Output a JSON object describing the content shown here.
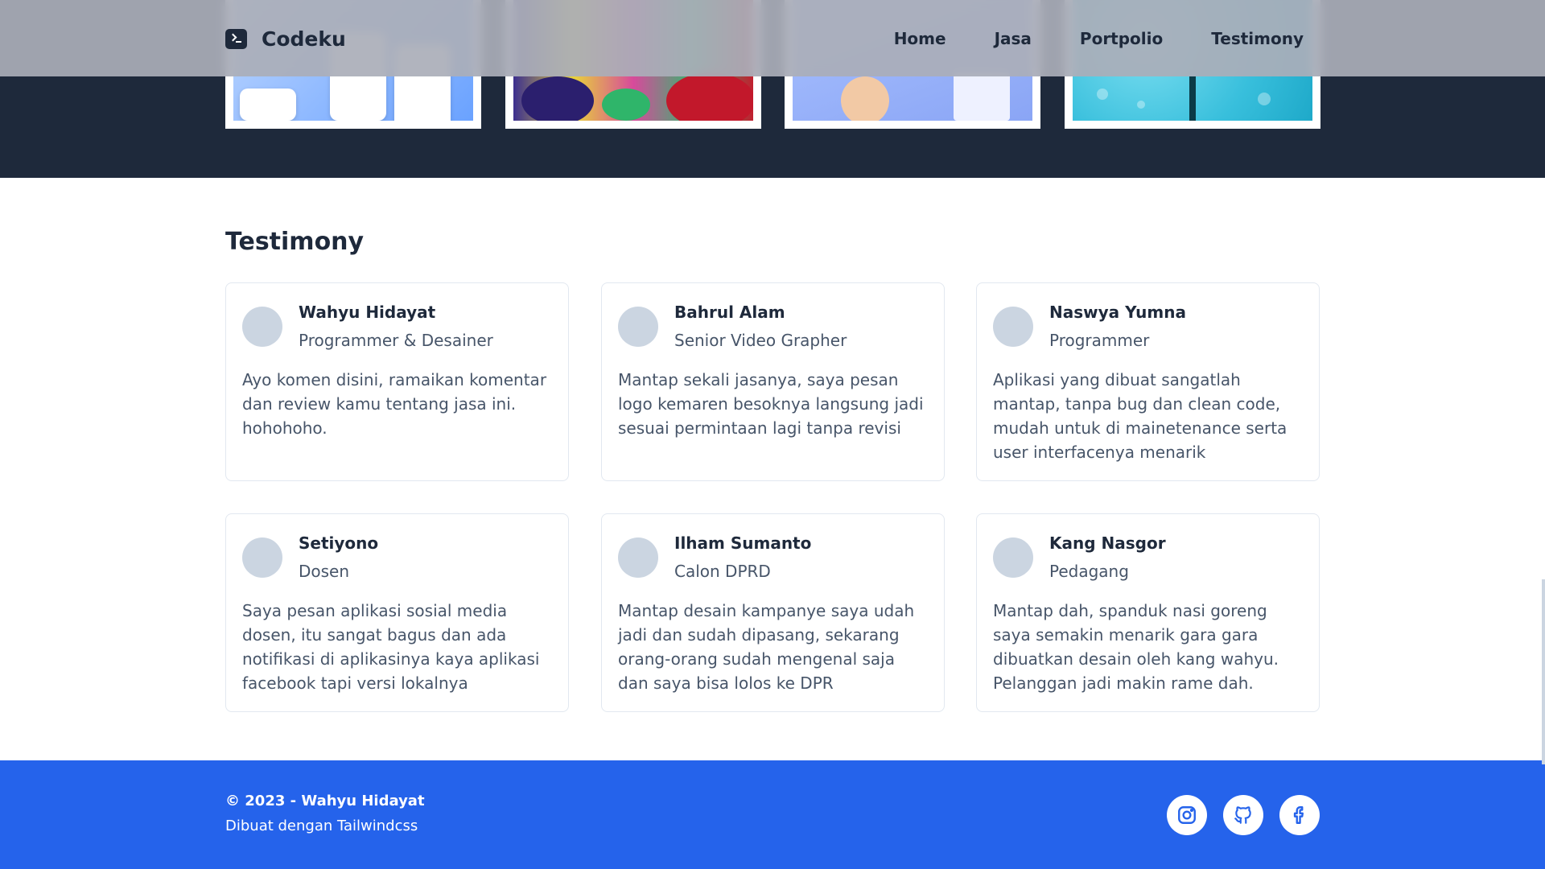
{
  "brand": {
    "name": "Codeku",
    "icon": "terminal-icon"
  },
  "nav": {
    "items": [
      "Home",
      "Jasa",
      "Portpolio",
      "Testimony"
    ]
  },
  "testimony": {
    "title": "Testimony",
    "items": [
      {
        "name": "Wahyu Hidayat",
        "role": "Programmer & Desainer",
        "text": "Ayo komen disini, ramaikan komentar dan review kamu tentang jasa ini. hohohoho."
      },
      {
        "name": "Bahrul Alam",
        "role": "Senior Video Grapher",
        "text": "Mantap sekali jasanya, saya pesan logo kemaren besoknya langsung jadi sesuai permintaan lagi tanpa revisi"
      },
      {
        "name": "Naswya Yumna",
        "role": "Programmer",
        "text": "Aplikasi yang dibuat sangatlah mantap, tanpa bug dan clean code, mudah untuk di mainetenance serta user interfacenya menarik"
      },
      {
        "name": "Setiyono",
        "role": "Dosen",
        "text": "Saya pesan aplikasi sosial media dosen, itu sangat bagus dan ada notifikasi di aplikasinya kaya aplikasi facebook tapi versi lokalnya"
      },
      {
        "name": "Ilham Sumanto",
        "role": "Calon DPRD",
        "text": "Mantap desain kampanye saya udah jadi dan sudah dipasang, sekarang orang-orang sudah mengenal saja dan saya bisa lolos ke DPR"
      },
      {
        "name": "Kang Nasgor",
        "role": "Pedagang",
        "text": "Mantap dah, spanduk nasi goreng saya semakin menarik gara gara dibuatkan desain oleh kang wahyu. Pelanggan jadi makin rame dah."
      }
    ]
  },
  "footer": {
    "copyright": "© 2023 - Wahyu Hidayat",
    "credit": "Dibuat dengan Tailwindcss",
    "socials": [
      "instagram-icon",
      "github-icon",
      "facebook-icon"
    ]
  },
  "colors": {
    "dark": "#1e293b",
    "footer": "#2563eb",
    "avatar": "#cbd5e1"
  }
}
